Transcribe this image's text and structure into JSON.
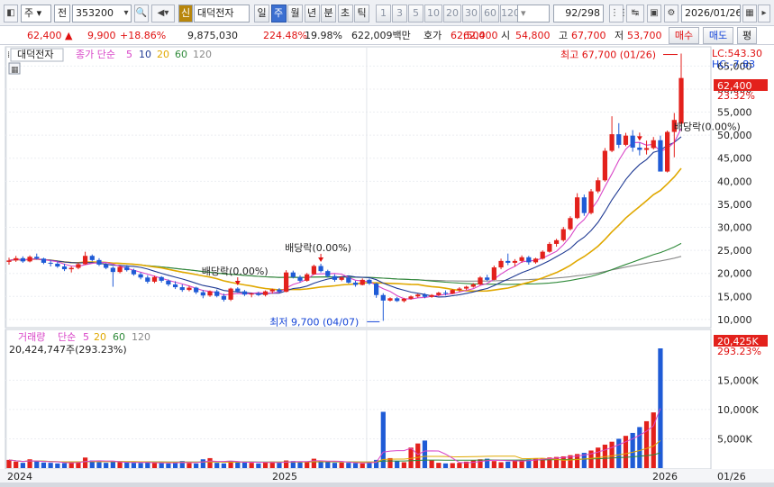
{
  "toolbar": {
    "market_type": "주",
    "market_scope": "전",
    "stock_code": "353200",
    "credit_badge": "신",
    "stock_name": "대덕전자",
    "period_buttons": [
      "일",
      "주",
      "월",
      "년",
      "분",
      "초",
      "틱"
    ],
    "selected_period": "주",
    "interval_buttons": [
      "1",
      "3",
      "5",
      "10",
      "20",
      "30",
      "60",
      "120"
    ],
    "page_position": "92/298",
    "date": "2026/01/26"
  },
  "info_bar": {
    "price": "62,400",
    "change_arrow": "▲",
    "change": "9,900",
    "change_pct": "+18.86%",
    "volume": "9,875,030",
    "volume_ratio": "224.48%",
    "turnover": "19.98%",
    "trade_value": "622,009백만",
    "quote_label": "호가",
    "ask": "62,500",
    "bid": "62,400",
    "open_label": "시",
    "open": "54,800",
    "high_label": "고",
    "high": "67,700",
    "low_label": "저",
    "low": "53,700",
    "buy_label": "매수",
    "sell_label": "매도",
    "eval_label": "평"
  },
  "price_panel": {
    "title": "대덕전자",
    "indicator_label": "종가 단순",
    "ma_periods": [
      "5",
      "10",
      "20",
      "60",
      "120"
    ],
    "lc_label": "LC:543.30",
    "hc_label": "HC:-7.83",
    "current_price_tag": "62,400",
    "current_pct_tag": "23.32%",
    "y_axis_labels": [
      "65,000",
      "60,000",
      "55,000",
      "50,000",
      "45,000",
      "40,000",
      "35,000",
      "30,000",
      "25,000",
      "20,000",
      "15,000",
      "10,000"
    ],
    "annotations": {
      "high": "최고 67,700 (01/26)",
      "low": "최저 9,700 (04/07)",
      "dividend": "배당락(0.00%)"
    }
  },
  "volume_panel": {
    "indicator_label": "거래량",
    "ma_label": "단순",
    "ma_periods": [
      "5",
      "20",
      "60",
      "120"
    ],
    "volume_summary": "20,424,747주(293.23%)",
    "current_volume_tag": "20,425K",
    "current_pct_tag": "293.23%",
    "y_axis_labels": [
      "15,000K",
      "10,000K",
      "5,000K"
    ]
  },
  "x_axis": {
    "labels": [
      "2024",
      "2025",
      "2026"
    ],
    "current_date": "01/26"
  },
  "colors": {
    "up": "#e3211c",
    "down": "#1f5bd6",
    "ma5": "#d946c8",
    "ma10": "#1f3a93",
    "ma20": "#e0a800",
    "ma60": "#2f8a3a",
    "ma120": "#8a8a8a"
  },
  "chart_data": {
    "type": "candlestick",
    "interval": "weekly",
    "start_week": "2024-01-01",
    "candles": [
      {
        "o": 22500,
        "h": 23400,
        "l": 21900,
        "c": 22800
      },
      {
        "o": 22800,
        "h": 23800,
        "l": 22500,
        "c": 23300
      },
      {
        "o": 23300,
        "h": 23700,
        "l": 22300,
        "c": 22600
      },
      {
        "o": 22600,
        "h": 23900,
        "l": 22400,
        "c": 23600
      },
      {
        "o": 23600,
        "h": 24300,
        "l": 23000,
        "c": 23200
      },
      {
        "o": 23200,
        "h": 23400,
        "l": 22000,
        "c": 22300
      },
      {
        "o": 22300,
        "h": 22800,
        "l": 21500,
        "c": 22100
      },
      {
        "o": 22100,
        "h": 22600,
        "l": 21200,
        "c": 21500
      },
      {
        "o": 21500,
        "h": 22100,
        "l": 20500,
        "c": 20900
      },
      {
        "o": 20900,
        "h": 21500,
        "l": 20200,
        "c": 21200
      },
      {
        "o": 21200,
        "h": 22300,
        "l": 20900,
        "c": 22000
      },
      {
        "o": 22000,
        "h": 24700,
        "l": 21900,
        "c": 23800
      },
      {
        "o": 23800,
        "h": 24100,
        "l": 22600,
        "c": 22900
      },
      {
        "o": 22900,
        "h": 23300,
        "l": 21600,
        "c": 21900
      },
      {
        "o": 21900,
        "h": 22200,
        "l": 20900,
        "c": 21200
      },
      {
        "o": 21200,
        "h": 21500,
        "l": 17100,
        "c": 20300
      },
      {
        "o": 20300,
        "h": 21700,
        "l": 20000,
        "c": 21400
      },
      {
        "o": 21400,
        "h": 21800,
        "l": 20400,
        "c": 20700
      },
      {
        "o": 20700,
        "h": 21000,
        "l": 19500,
        "c": 19800
      },
      {
        "o": 19800,
        "h": 20200,
        "l": 18700,
        "c": 19100
      },
      {
        "o": 19100,
        "h": 19600,
        "l": 17800,
        "c": 18200
      },
      {
        "o": 18200,
        "h": 19500,
        "l": 17900,
        "c": 19200
      },
      {
        "o": 19200,
        "h": 19400,
        "l": 18000,
        "c": 18400
      },
      {
        "o": 18400,
        "h": 18700,
        "l": 17200,
        "c": 17600
      },
      {
        "o": 17600,
        "h": 18300,
        "l": 16600,
        "c": 17000
      },
      {
        "o": 17000,
        "h": 17600,
        "l": 16000,
        "c": 16400
      },
      {
        "o": 16400,
        "h": 17300,
        "l": 16100,
        "c": 16900
      },
      {
        "o": 16900,
        "h": 17100,
        "l": 15500,
        "c": 15900
      },
      {
        "o": 15900,
        "h": 16400,
        "l": 14600,
        "c": 15200
      },
      {
        "o": 15200,
        "h": 16300,
        "l": 14900,
        "c": 16100
      },
      {
        "o": 16100,
        "h": 16500,
        "l": 14800,
        "c": 15100
      },
      {
        "o": 15100,
        "h": 15600,
        "l": 13900,
        "c": 14300
      },
      {
        "o": 14300,
        "h": 16900,
        "l": 14000,
        "c": 16700
      },
      {
        "o": 16700,
        "h": 17000,
        "l": 15800,
        "c": 16100
      },
      {
        "o": 16100,
        "h": 16400,
        "l": 15100,
        "c": 15400
      },
      {
        "o": 15400,
        "h": 15800,
        "l": 14800,
        "c": 15600
      },
      {
        "o": 15600,
        "h": 16000,
        "l": 15100,
        "c": 15300
      },
      {
        "o": 15300,
        "h": 16300,
        "l": 15000,
        "c": 16100
      },
      {
        "o": 16100,
        "h": 16700,
        "l": 15600,
        "c": 16500
      },
      {
        "o": 16500,
        "h": 16800,
        "l": 15800,
        "c": 16000
      },
      {
        "o": 16000,
        "h": 20700,
        "l": 15900,
        "c": 20200
      },
      {
        "o": 20200,
        "h": 20600,
        "l": 18900,
        "c": 19200
      },
      {
        "o": 19200,
        "h": 19600,
        "l": 18000,
        "c": 18400
      },
      {
        "o": 18400,
        "h": 20100,
        "l": 18200,
        "c": 19800
      },
      {
        "o": 19800,
        "h": 21900,
        "l": 19700,
        "c": 21600
      },
      {
        "o": 21600,
        "h": 22100,
        "l": 20200,
        "c": 20500
      },
      {
        "o": 20500,
        "h": 20800,
        "l": 19100,
        "c": 19400
      },
      {
        "o": 19400,
        "h": 19800,
        "l": 18200,
        "c": 18600
      },
      {
        "o": 18600,
        "h": 19400,
        "l": 18300,
        "c": 19100
      },
      {
        "o": 19100,
        "h": 19500,
        "l": 17800,
        "c": 18000
      },
      {
        "o": 18000,
        "h": 18400,
        "l": 17100,
        "c": 17500
      },
      {
        "o": 17500,
        "h": 18900,
        "l": 17400,
        "c": 18600
      },
      {
        "o": 18600,
        "h": 18900,
        "l": 17500,
        "c": 17800
      },
      {
        "o": 17800,
        "h": 18000,
        "l": 14700,
        "c": 15300
      },
      {
        "o": 15300,
        "h": 15700,
        "l": 9700,
        "c": 14100
      },
      {
        "o": 14100,
        "h": 14800,
        "l": 13900,
        "c": 14600
      },
      {
        "o": 14600,
        "h": 14900,
        "l": 13800,
        "c": 14000
      },
      {
        "o": 14000,
        "h": 14700,
        "l": 13700,
        "c": 14500
      },
      {
        "o": 14500,
        "h": 15200,
        "l": 14300,
        "c": 15000
      },
      {
        "o": 15000,
        "h": 15600,
        "l": 14700,
        "c": 15400
      },
      {
        "o": 15400,
        "h": 15700,
        "l": 14600,
        "c": 14900
      },
      {
        "o": 14900,
        "h": 15500,
        "l": 14700,
        "c": 15300
      },
      {
        "o": 15300,
        "h": 16000,
        "l": 15100,
        "c": 15800
      },
      {
        "o": 15800,
        "h": 16300,
        "l": 15200,
        "c": 15600
      },
      {
        "o": 15600,
        "h": 16600,
        "l": 15500,
        "c": 16400
      },
      {
        "o": 16400,
        "h": 17000,
        "l": 16000,
        "c": 16700
      },
      {
        "o": 16700,
        "h": 17300,
        "l": 16400,
        "c": 17100
      },
      {
        "o": 17100,
        "h": 17900,
        "l": 16900,
        "c": 17600
      },
      {
        "o": 17600,
        "h": 19400,
        "l": 17400,
        "c": 19100
      },
      {
        "o": 19100,
        "h": 19700,
        "l": 18300,
        "c": 18600
      },
      {
        "o": 18600,
        "h": 21700,
        "l": 18500,
        "c": 21300
      },
      {
        "o": 21300,
        "h": 23200,
        "l": 20900,
        "c": 22700
      },
      {
        "o": 22700,
        "h": 24300,
        "l": 21800,
        "c": 22300
      },
      {
        "o": 22300,
        "h": 23100,
        "l": 21500,
        "c": 22700
      },
      {
        "o": 22700,
        "h": 23900,
        "l": 22300,
        "c": 23500
      },
      {
        "o": 23500,
        "h": 23800,
        "l": 21900,
        "c": 22400
      },
      {
        "o": 22400,
        "h": 23400,
        "l": 22100,
        "c": 23200
      },
      {
        "o": 23200,
        "h": 25000,
        "l": 23000,
        "c": 24700
      },
      {
        "o": 24700,
        "h": 26800,
        "l": 24500,
        "c": 26400
      },
      {
        "o": 26400,
        "h": 27500,
        "l": 25800,
        "c": 27200
      },
      {
        "o": 27200,
        "h": 30100,
        "l": 26900,
        "c": 29600
      },
      {
        "o": 29600,
        "h": 32400,
        "l": 29300,
        "c": 32000
      },
      {
        "o": 32000,
        "h": 37400,
        "l": 31800,
        "c": 36500
      },
      {
        "o": 36500,
        "h": 37100,
        "l": 32500,
        "c": 33100
      },
      {
        "o": 33100,
        "h": 38300,
        "l": 32800,
        "c": 37800
      },
      {
        "o": 37800,
        "h": 40800,
        "l": 37400,
        "c": 40200
      },
      {
        "o": 40200,
        "h": 47200,
        "l": 39900,
        "c": 46600
      },
      {
        "o": 46600,
        "h": 54100,
        "l": 46300,
        "c": 50200
      },
      {
        "o": 50200,
        "h": 52600,
        "l": 47200,
        "c": 47900
      },
      {
        "o": 47900,
        "h": 50500,
        "l": 47600,
        "c": 49900
      },
      {
        "o": 49900,
        "h": 51100,
        "l": 46400,
        "c": 47300
      },
      {
        "o": 47300,
        "h": 48400,
        "l": 45600,
        "c": 46800
      },
      {
        "o": 46800,
        "h": 48800,
        "l": 45800,
        "c": 47200
      },
      {
        "o": 47200,
        "h": 49600,
        "l": 46900,
        "c": 48900
      },
      {
        "o": 48900,
        "h": 49900,
        "l": 45900,
        "c": 42100
      },
      {
        "o": 42100,
        "h": 51000,
        "l": 41900,
        "c": 50700
      },
      {
        "o": 50700,
        "h": 54800,
        "l": 45200,
        "c": 53300
      },
      {
        "o": 52500,
        "h": 67700,
        "l": 52300,
        "c": 62400
      }
    ],
    "volume_k": [
      1400,
      1100,
      900,
      1500,
      1200,
      950,
      900,
      800,
      850,
      1000,
      1100,
      1800,
      1300,
      1000,
      900,
      1100,
      1000,
      950,
      900,
      880,
      1000,
      900,
      850,
      800,
      1000,
      1200,
      850,
      780,
      1500,
      1700,
      900,
      800,
      1200,
      1100,
      1000,
      900,
      800,
      950,
      1100,
      900,
      1300,
      1200,
      1000,
      1100,
      1600,
      1300,
      1000,
      900,
      950,
      900,
      850,
      800,
      1000,
      1400,
      9600,
      1700,
      1200,
      1000,
      3500,
      4200,
      4700,
      1300,
      900,
      800,
      850,
      900,
      1100,
      1300,
      1500,
      1600,
      1200,
      1000,
      1100,
      1300,
      1400,
      1500,
      1600,
      1700,
      1800,
      1900,
      2000,
      2200,
      2400,
      2600,
      3000,
      3500,
      4000,
      4500,
      5000,
      5500,
      6000,
      7000,
      8000,
      9500,
      20425
    ],
    "ylim": [
      9000,
      68000
    ],
    "x_axis_labels": [
      "2024",
      "2025",
      "2026"
    ]
  }
}
